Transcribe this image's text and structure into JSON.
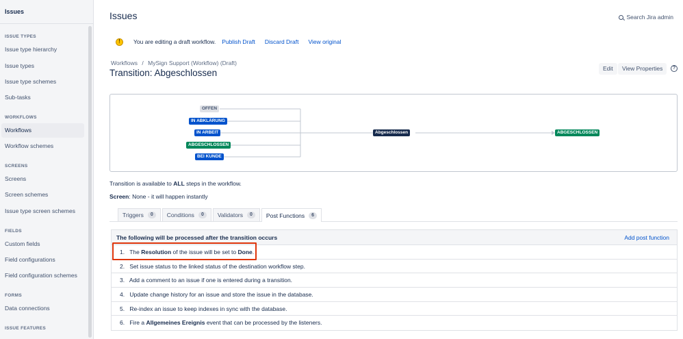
{
  "sidebar": {
    "title": "Issues",
    "sections": [
      {
        "heading": "ISSUE TYPES",
        "items": [
          "Issue type hierarchy",
          "Issue types",
          "Issue type schemes",
          "Sub-tasks"
        ]
      },
      {
        "heading": "WORKFLOWS",
        "items": [
          "Workflows",
          "Workflow schemes"
        ]
      },
      {
        "heading": "SCREENS",
        "items": [
          "Screens",
          "Screen schemes",
          "Issue type screen schemes"
        ]
      },
      {
        "heading": "FIELDS",
        "items": [
          "Custom fields",
          "Field configurations",
          "Field configuration schemes"
        ]
      },
      {
        "heading": "FORMS",
        "items": [
          "Data connections"
        ]
      },
      {
        "heading": "ISSUE FEATURES",
        "items": []
      }
    ],
    "active_item": "Workflows"
  },
  "header": {
    "title": "Issues",
    "search_label": "Search Jira admin"
  },
  "draft_bar": {
    "text": "You are editing a draft workflow.",
    "publish": "Publish Draft",
    "discard": "Discard Draft",
    "view_original": "View original"
  },
  "breadcrumb": {
    "workflows": "Workflows",
    "separator": "/",
    "current": "MySign Support (Workflow) (Draft)"
  },
  "transition_title": "Transition: Abgeschlossen",
  "buttons": {
    "edit": "Edit",
    "view_properties": "View Properties",
    "help": "?"
  },
  "diagram": {
    "from_statuses": [
      {
        "label": "OFFEN",
        "color": "grey"
      },
      {
        "label": "IN ABKLÄRUNG",
        "color": "blue"
      },
      {
        "label": "IN ARBEIT",
        "color": "blue"
      },
      {
        "label": "ABGESCHLOSSEN",
        "color": "green"
      },
      {
        "label": "BEI KUNDE",
        "color": "blue"
      }
    ],
    "transition": "Abgeschlossen",
    "to_status": {
      "label": "ABGESCHLOSSEN",
      "color": "green"
    }
  },
  "info": {
    "available_prefix": "Transition is available to ",
    "available_bold": "ALL",
    "available_suffix": " steps in the workflow.",
    "screen_label": "Screen",
    "screen_value": ": None - it will happen instantly"
  },
  "tabs": [
    {
      "label": "Triggers",
      "count": "0"
    },
    {
      "label": "Conditions",
      "count": "0"
    },
    {
      "label": "Validators",
      "count": "0"
    },
    {
      "label": "Post Functions",
      "count": "6",
      "active": true
    }
  ],
  "post_functions": {
    "header": "The following will be processed after the transition occurs",
    "add_label": "Add post function",
    "rows": [
      {
        "num": "1.",
        "parts": [
          "The ",
          "Resolution",
          " of the issue will be set to ",
          "Done",
          "."
        ]
      },
      {
        "num": "2.",
        "text": "Set issue status to the linked status of the destination workflow step."
      },
      {
        "num": "3.",
        "text": "Add a comment to an issue if one is entered during a transition."
      },
      {
        "num": "4.",
        "text": "Update change history for an issue and store the issue in the database."
      },
      {
        "num": "5.",
        "text": "Re-index an issue to keep indexes in sync with the database."
      },
      {
        "num": "6.",
        "parts": [
          "Fire a ",
          "Allgemeines Ereignis",
          " event that can be processed by the listeners."
        ]
      }
    ]
  },
  "colors": {
    "link": "#0052cc",
    "highlight": "#de350b",
    "green": "#00875a",
    "blue": "#0052cc"
  }
}
